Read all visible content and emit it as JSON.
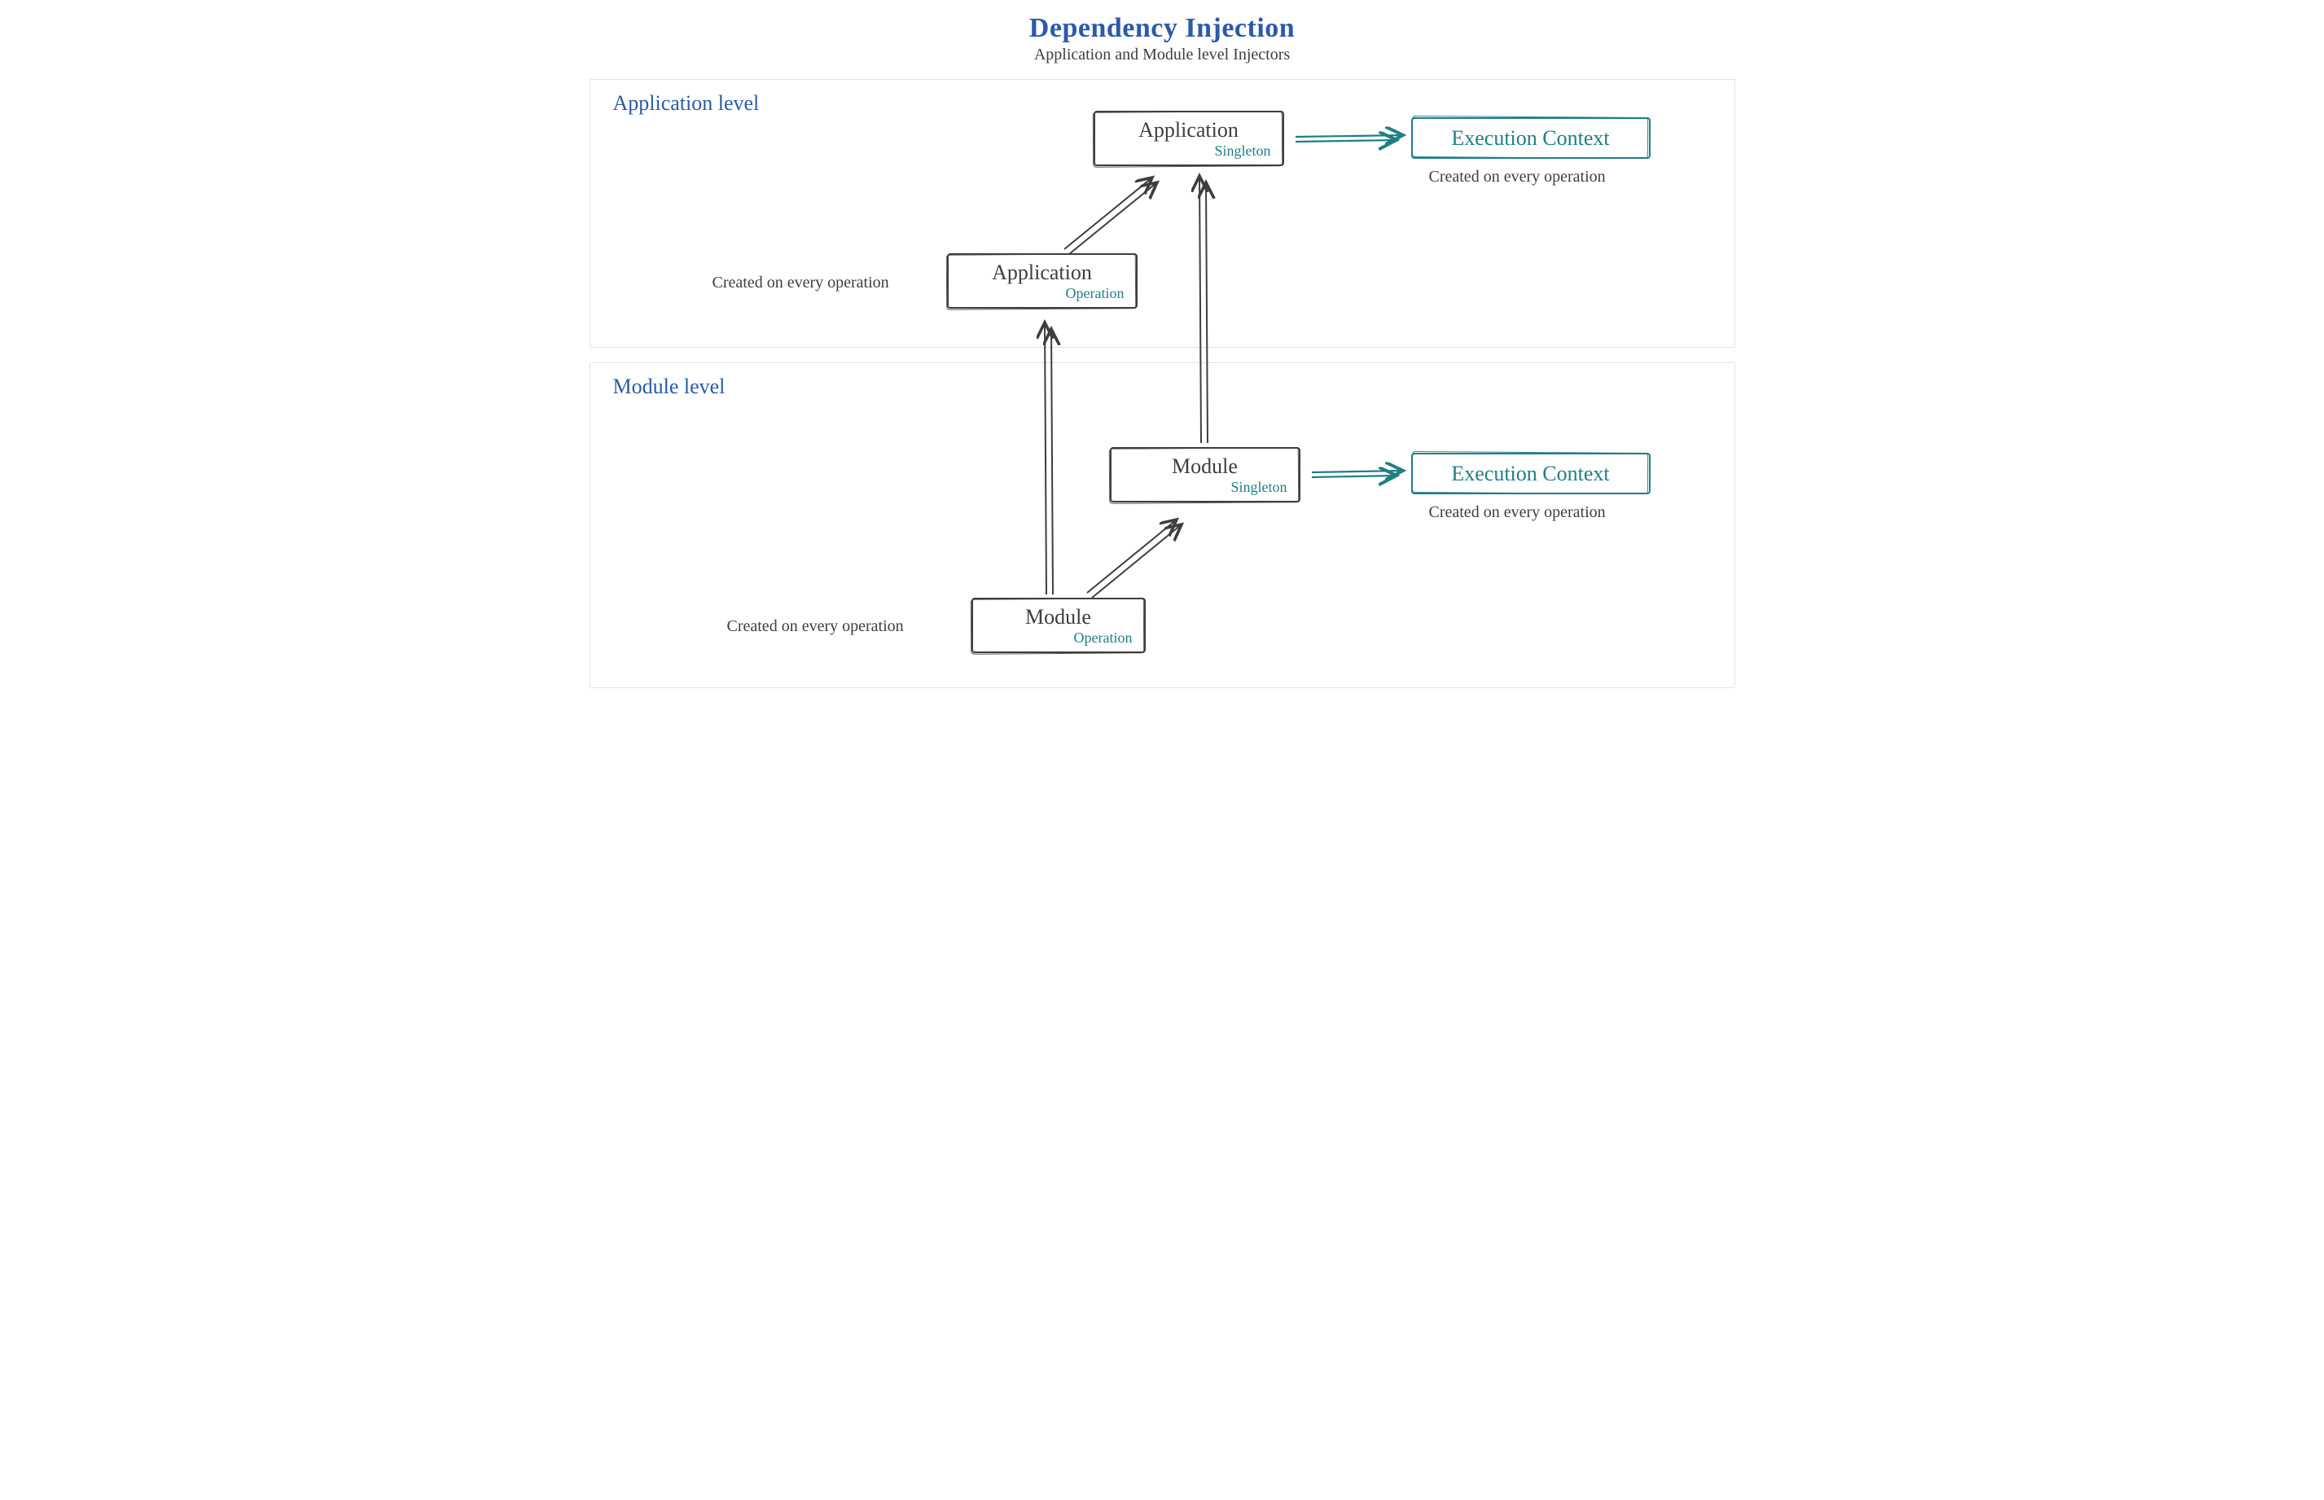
{
  "title": "Dependency Injection",
  "subtitle": "Application and Module level Injectors",
  "captions": {
    "created": "Created on every operation"
  },
  "levels": {
    "app": {
      "label": "Application level",
      "singleton": {
        "name": "Application",
        "tag": "Singleton"
      },
      "operation": {
        "name": "Application",
        "tag": "Operation"
      },
      "context": {
        "name": "Execution Context"
      }
    },
    "mod": {
      "label": "Module level",
      "singleton": {
        "name": "Module",
        "tag": "Singleton"
      },
      "operation": {
        "name": "Module",
        "tag": "Operation"
      },
      "context": {
        "name": "Execution Context"
      }
    }
  }
}
